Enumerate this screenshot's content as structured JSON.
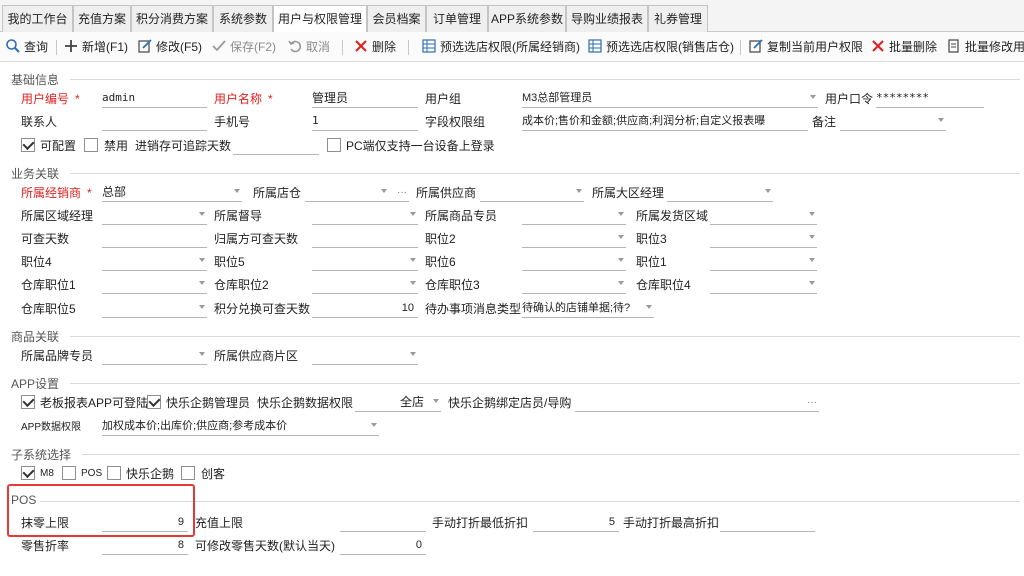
{
  "tabs": [
    "我的工作台",
    "充值方案",
    "积分消费方案",
    "系统参数",
    "用户与权限管理",
    "会员档案",
    "订单管理",
    "APP系统参数",
    "导购业绩报表",
    "礼券管理"
  ],
  "toolbar": {
    "query": "查询",
    "add": "新增(F1)",
    "edit": "修改(F5)",
    "save": "保存(F2)",
    "cancel": "取消",
    "delete": "删除",
    "preselect_dealer": "预选选店权限(所属经销商)",
    "preselect_store": "预选选店权限(销售店仓)",
    "copy_user_perm": "复制当前用户权限",
    "batch_delete": "批量删除",
    "batch_edit": "批量修改用"
  },
  "basic": {
    "section": "基础信息",
    "user_code_label": "用户编号",
    "user_code": "admin",
    "user_name_label": "用户名称",
    "user_name": "管理员",
    "user_group_label": "用户组",
    "user_group": "M3总部管理员",
    "password_label": "用户口令",
    "password": "********",
    "contact_label": "联系人",
    "contact": "",
    "phone_label": "手机号",
    "phone": "1",
    "field_perm_label": "字段权限组",
    "field_perm": "成本价;售价和金额;供应商;利润分析;自定义报表曝",
    "remark_label": "备注",
    "remark": "",
    "configurable_label": "可配置",
    "disabled_label": "禁用",
    "trace_days_label": "进销存可追踪天数",
    "trace_days": "",
    "pc_single_label": "PC端仅支持一台设备上登录"
  },
  "business": {
    "section": "业务关联",
    "dealer_label": "所属经销商",
    "dealer": "总部",
    "store_label": "所属店仓",
    "supplier_label": "所属供应商",
    "region_mgr_label": "所属大区经理",
    "area_mgr_label": "所属区域经理",
    "supervisor_label": "所属督导",
    "product_specialist_label": "所属商品专员",
    "ship_area_label": "所属发货区域",
    "query_days_label": "可查天数",
    "owner_query_days_label": "归属方可查天数",
    "pos2_label": "职位2",
    "pos3_label": "职位3",
    "pos4_label": "职位4",
    "pos5_label": "职位5",
    "pos6_label": "职位6",
    "pos1_label": "职位1",
    "wh_pos1_label": "仓库职位1",
    "wh_pos2_label": "仓库职位2",
    "wh_pos3_label": "仓库职位3",
    "wh_pos4_label": "仓库职位4",
    "wh_pos5_label": "仓库职位5",
    "points_days_label": "积分兑换可查天数",
    "points_days": "10",
    "todo_type_label": "待办事项消息类型",
    "todo_type": "待确认的店铺单据;待?"
  },
  "product": {
    "section": "商品关联",
    "brand_specialist_label": "所属品牌专员",
    "supplier_area_label": "所属供应商片区"
  },
  "app": {
    "section": "APP设置",
    "boss_report_label": "老板报表APP可登陆",
    "kuaile_admin_label": "快乐企鹅管理员",
    "kuaile_data_label": "快乐企鹅数据权限",
    "kuaile_data": "全店",
    "kuaile_bind_label": "快乐企鹅绑定店员/导购",
    "app_data_perm_label": "APP数据权限",
    "app_data_perm": "加权成本价;出库价;供应商;参考成本价"
  },
  "subsystem": {
    "section": "子系统选择",
    "m8": "M8",
    "pos": "POS",
    "kuaile": "快乐企鹅",
    "kehu": "创客"
  },
  "pos": {
    "section": "POS",
    "rounding_label": "抹零上限",
    "rounding": "9",
    "recharge_label": "充值上限",
    "recharge": "",
    "min_discount_label": "手动打折最低折扣",
    "min_discount": "5",
    "max_discount_label": "手动打折最高折扣",
    "max_discount": "",
    "retail_discount_label": "零售折率",
    "retail_discount": "8",
    "edit_days_label": "可修改零售天数(默认当天)",
    "edit_days": "0"
  },
  "colors": {
    "required": "#e02020",
    "highlight_box": "#e53935",
    "accent": "#2f6fb3"
  }
}
